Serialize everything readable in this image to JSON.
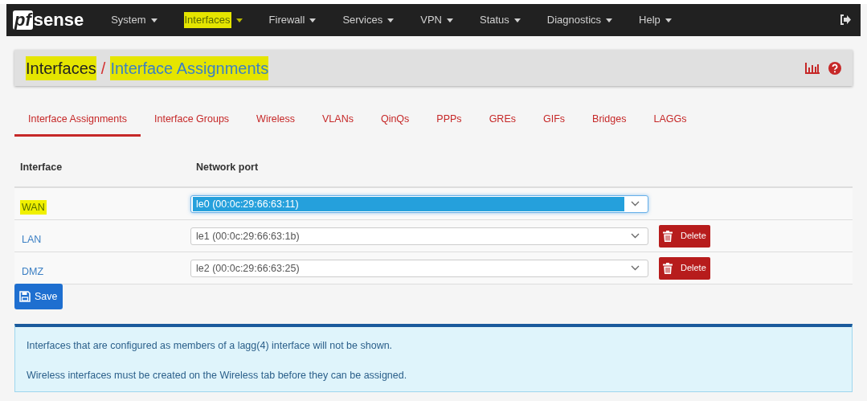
{
  "brand": {
    "logo_left": "pf",
    "logo_right": "sense"
  },
  "nav": [
    {
      "label": "System",
      "highlighted": false
    },
    {
      "label": "Interfaces",
      "highlighted": true
    },
    {
      "label": "Firewall",
      "highlighted": false
    },
    {
      "label": "Services",
      "highlighted": false
    },
    {
      "label": "VPN",
      "highlighted": false
    },
    {
      "label": "Status",
      "highlighted": false
    },
    {
      "label": "Diagnostics",
      "highlighted": false
    },
    {
      "label": "Help",
      "highlighted": false
    }
  ],
  "breadcrumb": {
    "parent": "Interfaces",
    "separator": "/",
    "current": "Interface Assignments",
    "highlighted": true
  },
  "tabs": [
    {
      "label": "Interface Assignments",
      "selected": true
    },
    {
      "label": "Interface Groups",
      "selected": false
    },
    {
      "label": "Wireless",
      "selected": false
    },
    {
      "label": "VLANs",
      "selected": false
    },
    {
      "label": "QinQs",
      "selected": false
    },
    {
      "label": "PPPs",
      "selected": false
    },
    {
      "label": "GREs",
      "selected": false
    },
    {
      "label": "GIFs",
      "selected": false
    },
    {
      "label": "Bridges",
      "selected": false
    },
    {
      "label": "LAGGs",
      "selected": false
    }
  ],
  "table": {
    "columns": [
      "Interface",
      "Network port"
    ],
    "rows": [
      {
        "interface": "WAN",
        "highlighted": true,
        "port": "le0 (00:0c:29:66:63:11)",
        "focused": true,
        "delete": null
      },
      {
        "interface": "LAN",
        "highlighted": false,
        "port": "le1 (00:0c:29:66:63:1b)",
        "focused": false,
        "delete": "Delete"
      },
      {
        "interface": "DMZ",
        "highlighted": false,
        "port": "le2 (00:0c:29:66:63:25)",
        "focused": false,
        "delete": "Delete"
      }
    ]
  },
  "save_button": "Save",
  "info": [
    "Interfaces that are configured as members of a lagg(4) interface will not be shown.",
    "Wireless interfaces must be created on the Wireless tab before they can be assigned."
  ]
}
